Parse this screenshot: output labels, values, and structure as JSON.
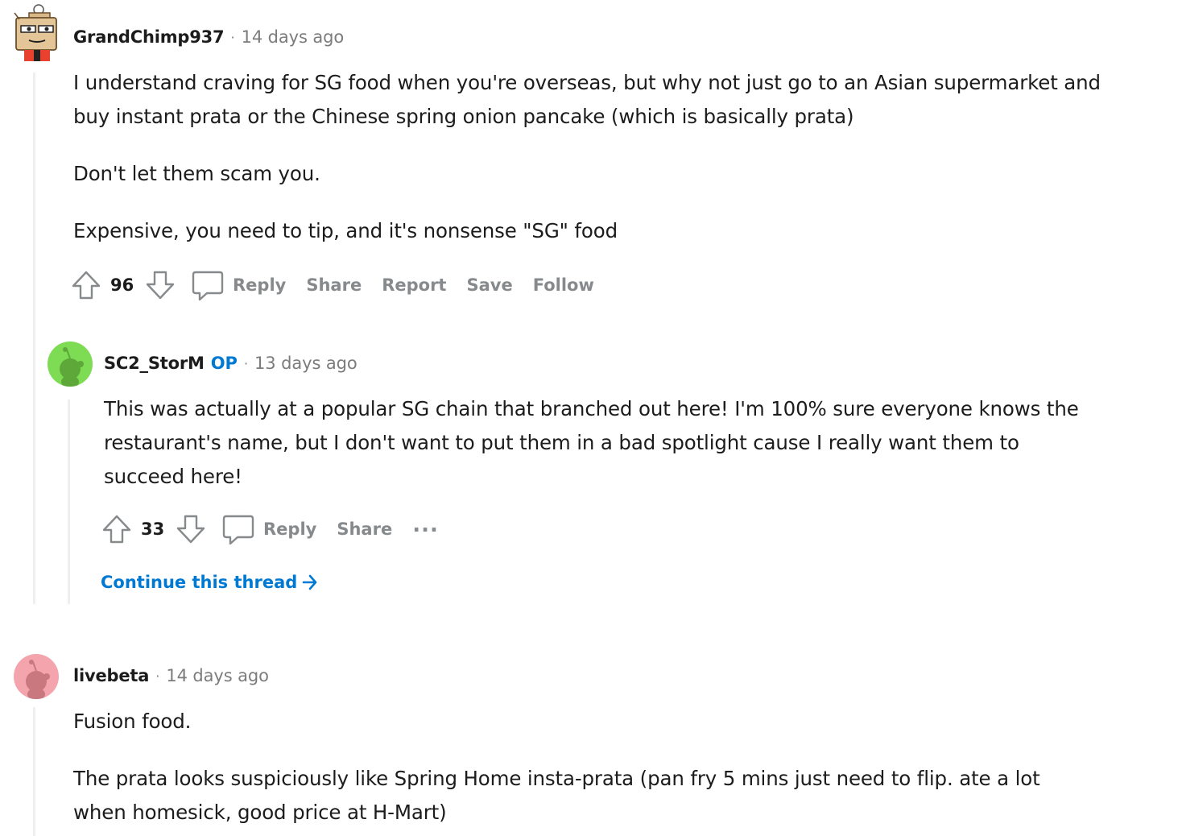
{
  "comments": [
    {
      "username": "GrandChimp937",
      "time": "14 days ago",
      "body": [
        "I understand craving for SG food when you're overseas, but why not just go to an Asian supermarket and buy instant prata or the Chinese spring onion pancake (which is basically prata)",
        "Don't let them scam you.",
        "Expensive, you need to tip, and it's nonsense \"SG\" food"
      ],
      "score": "96",
      "actions": {
        "reply": "Reply",
        "share": "Share",
        "report": "Report",
        "save": "Save",
        "follow": "Follow"
      }
    },
    {
      "username": "SC2_StorM",
      "op_badge": "OP",
      "time": "13 days ago",
      "body": [
        "This was actually at a popular SG chain that branched out here! I'm 100% sure everyone knows the restaurant's name, but I don't want to put them in a bad spotlight cause I really want them to succeed here!"
      ],
      "score": "33",
      "actions": {
        "reply": "Reply",
        "share": "Share",
        "more": "..."
      },
      "continue_thread": "Continue this thread"
    },
    {
      "username": "livebeta",
      "time": "14 days ago",
      "body": [
        "Fusion food.",
        "The prata looks suspiciously like Spring Home insta-prata (pan fry 5 mins just need to flip. ate a lot when homesick, good price at H-Mart)"
      ]
    }
  ],
  "icons": {
    "upvote": "upvote-arrow-icon",
    "downvote": "downvote-arrow-icon",
    "reply": "comment-bubble-icon",
    "more": "more-options-icon",
    "continue": "arrow-right-icon"
  },
  "colors": {
    "op": "#0079d3",
    "link": "#0079d3",
    "meta": "#7c7c7c",
    "action": "#878a8c",
    "avatar_green": "#7ddc54",
    "avatar_pink": "#f4a4ad"
  }
}
